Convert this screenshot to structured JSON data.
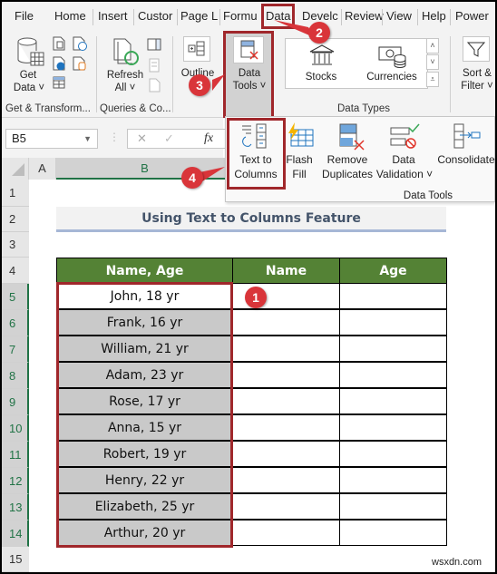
{
  "menu": {
    "tabs": [
      {
        "label": "File"
      },
      {
        "label": "Home"
      },
      {
        "label": "Insert"
      },
      {
        "label": "Custor"
      },
      {
        "label": "Page L"
      },
      {
        "label": "Formu"
      },
      {
        "label": "Data"
      },
      {
        "label": "Develc"
      },
      {
        "label": "Review"
      },
      {
        "label": "View"
      },
      {
        "label": "Help"
      },
      {
        "label": "Power"
      }
    ],
    "active_tab": "Data"
  },
  "ribbon": {
    "get_transform": {
      "get_data_line1": "Get",
      "get_data_line2": "Data ˅",
      "group_label": "Get & Transform..."
    },
    "queries": {
      "refresh_line1": "Refresh",
      "refresh_line2": "All ˅",
      "group_label": "Queries & Co..."
    },
    "outline": {
      "label": "Outline"
    },
    "data_tools_button": {
      "line1": "Data",
      "line2": "Tools ˅"
    },
    "data_types": {
      "stocks": "Stocks",
      "currencies": "Currencies",
      "group_label": "Data Types"
    },
    "sort_filter": {
      "line1": "Sort &",
      "line2": "Filter ˅"
    }
  },
  "data_tools_panel": {
    "items": [
      {
        "line1": "Text to",
        "line2": "Columns"
      },
      {
        "line1": "Flash",
        "line2": "Fill"
      },
      {
        "line1": "Remove",
        "line2": "Duplicates"
      },
      {
        "line1": "Data",
        "line2": "Validation ˅"
      },
      {
        "line1": "Consolidate",
        "line2": ""
      }
    ],
    "group_label": "Data Tools"
  },
  "formula_bar": {
    "name_box": "B5",
    "cancel": "✕",
    "confirm": "✓",
    "fx": "fx",
    "formula": ""
  },
  "sheet": {
    "columns": [
      "A",
      "B"
    ],
    "rows": [
      "1",
      "2",
      "3",
      "4",
      "5",
      "6",
      "7",
      "8",
      "9",
      "10",
      "11",
      "12",
      "13",
      "14",
      "15"
    ],
    "title": "Using Text to Columns Feature",
    "table_headers": [
      "Name, Age",
      "Name",
      "Age"
    ],
    "table_rows": [
      "John, 18 yr",
      "Frank, 16 yr",
      "William, 21 yr",
      "Adam, 23 yr",
      "Rose, 17 yr",
      "Anna, 15 yr",
      "Robert, 19 yr",
      "Henry, 22 yr",
      "Elizabeth, 25 yr",
      "Arthur, 20 yr"
    ]
  },
  "callouts": [
    "1",
    "2",
    "3",
    "4"
  ],
  "watermark": "wsxdn.com",
  "colors": {
    "accent_red": "#a0272b",
    "badge_red": "#d9353a",
    "header_green": "#548235",
    "excel_green": "#217346",
    "title_text": "#44546a"
  }
}
